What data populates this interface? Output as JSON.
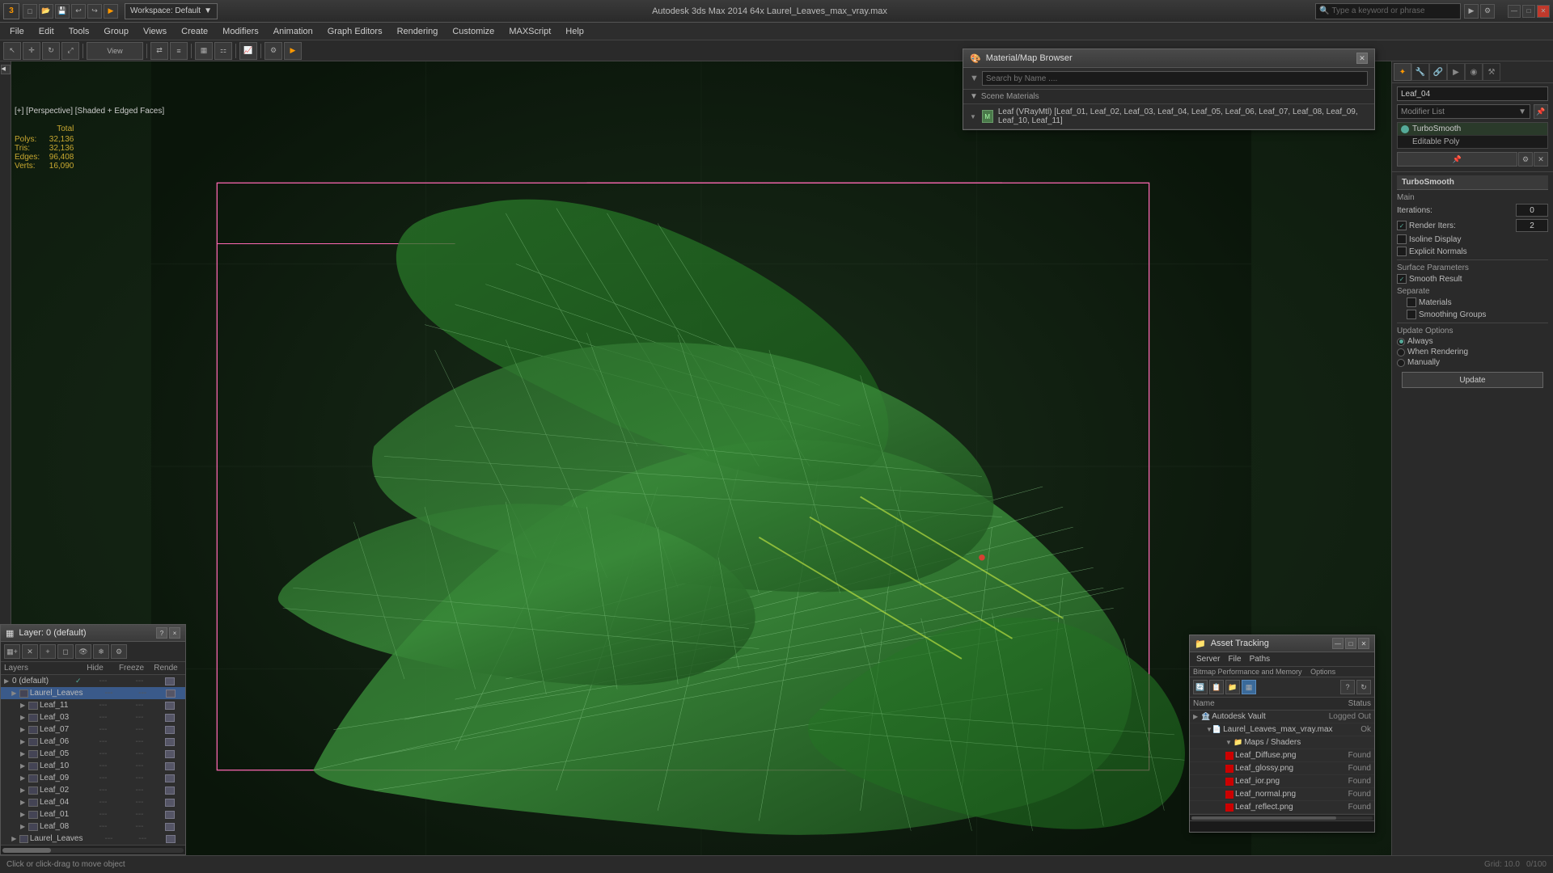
{
  "titlebar": {
    "logo": "3",
    "title": "Autodesk 3ds Max 2014 64x          Laurel_Leaves_max_vray.max",
    "workspace_label": "Workspace: Default",
    "search_placeholder": "Type a keyword or phrase",
    "window_controls": [
      "_",
      "□",
      "×"
    ]
  },
  "menubar": {
    "items": [
      "File",
      "Edit",
      "Tools",
      "Group",
      "Views",
      "Create",
      "Modifiers",
      "Animation",
      "Graph Editors",
      "Rendering",
      "Customize",
      "MAXScript",
      "Help"
    ]
  },
  "viewport": {
    "label": "[+] [Perspective] [Shaded + Edged Faces]",
    "stats": {
      "total_label": "Total",
      "polys_label": "Polys:",
      "polys_value": "32,136",
      "tris_label": "Tris:",
      "tris_value": "32,136",
      "edges_label": "Edges:",
      "edges_value": "96,408",
      "verts_label": "Verts:",
      "verts_value": "16,090"
    }
  },
  "right_panel": {
    "object_name": "Leaf_04",
    "modifier_list_label": "Modifier List",
    "modifiers": [
      {
        "name": "TurboSmooth",
        "active": true
      },
      {
        "name": "Editable Poly",
        "active": false
      }
    ],
    "turbosmooth": {
      "title": "TurboSmooth",
      "main_label": "Main",
      "iterations_label": "Iterations:",
      "iterations_value": "0",
      "render_iters_label": "Render Iters:",
      "render_iters_value": "2",
      "isoline_display_label": "Isoline Display",
      "explicit_normals_label": "Explicit Normals",
      "surface_params_label": "Surface Parameters",
      "smooth_result_label": "Smooth Result",
      "smooth_result_checked": true,
      "separate_label": "Separate",
      "materials_label": "Materials",
      "smoothing_groups_label": "Smoothing Groups",
      "update_options_label": "Update Options",
      "always_label": "Always",
      "when_rendering_label": "When Rendering",
      "manually_label": "Manually",
      "update_btn": "Update"
    }
  },
  "layer_panel": {
    "title": "Layer: 0 (default)",
    "question_btn": "?",
    "close_btn": "×",
    "toolbar_icons": [
      "layer_new",
      "layer_delete",
      "layer_add",
      "layer_select",
      "layer_hide",
      "layer_freeze",
      "layer_settings"
    ],
    "columns": {
      "name": "Layers",
      "hide": "Hide",
      "freeze": "Freeze",
      "render": "Rende"
    },
    "layers": [
      {
        "level": 0,
        "name": "0 (default)",
        "checked": true,
        "hide": "---",
        "freeze": "---",
        "render": "icon"
      },
      {
        "level": 1,
        "name": "Laurel_Leaves",
        "checked": false,
        "hide": "---",
        "freeze": "---",
        "render": "icon",
        "selected": true
      },
      {
        "level": 2,
        "name": "Leaf_11",
        "hide": "---",
        "freeze": "---",
        "render": "icon"
      },
      {
        "level": 2,
        "name": "Leaf_03",
        "hide": "---",
        "freeze": "---",
        "render": "icon"
      },
      {
        "level": 2,
        "name": "Leaf_07",
        "hide": "---",
        "freeze": "---",
        "render": "icon"
      },
      {
        "level": 2,
        "name": "Leaf_06",
        "hide": "---",
        "freeze": "---",
        "render": "icon"
      },
      {
        "level": 2,
        "name": "Leaf_05",
        "hide": "---",
        "freeze": "---",
        "render": "icon"
      },
      {
        "level": 2,
        "name": "Leaf_10",
        "hide": "---",
        "freeze": "---",
        "render": "icon"
      },
      {
        "level": 2,
        "name": "Leaf_09",
        "hide": "---",
        "freeze": "---",
        "render": "icon"
      },
      {
        "level": 2,
        "name": "Leaf_02",
        "hide": "---",
        "freeze": "---",
        "render": "icon"
      },
      {
        "level": 2,
        "name": "Leaf_04",
        "hide": "---",
        "freeze": "---",
        "render": "icon"
      },
      {
        "level": 2,
        "name": "Leaf_01",
        "hide": "---",
        "freeze": "---",
        "render": "icon"
      },
      {
        "level": 2,
        "name": "Leaf_08",
        "hide": "---",
        "freeze": "---",
        "render": "icon"
      },
      {
        "level": 1,
        "name": "Laurel_Leaves",
        "hide": "---",
        "freeze": "---",
        "render": "icon"
      }
    ]
  },
  "mat_browser": {
    "title": "Material/Map Browser",
    "search_label": "Search by Name ....",
    "scene_materials_label": "Scene Materials",
    "material_item": "Leaf (VRayMtl) [Leaf_01, Leaf_02, Leaf_03, Leaf_04, Leaf_05, Leaf_06, Leaf_07, Leaf_08, Leaf_09, Leaf_10, Leaf_11]"
  },
  "asset_tracking": {
    "title": "Asset Tracking",
    "menu_items": [
      "Server",
      "File",
      "Paths",
      "Bitmap Performance and Memory",
      "Options"
    ],
    "columns": {
      "name": "Name",
      "status": "Status"
    },
    "items": [
      {
        "level": 0,
        "name": "Autodesk Vault",
        "status": "Logged Out",
        "expand": "▶"
      },
      {
        "level": 1,
        "name": "Laurel_Leaves_max_vray.max",
        "status": "Ok",
        "expand": "▼"
      },
      {
        "level": 2,
        "name": "Maps / Shaders",
        "status": "",
        "expand": "▼"
      },
      {
        "level": 3,
        "name": "Leaf_Diffuse.png",
        "status": "Found"
      },
      {
        "level": 3,
        "name": "Leaf_glossy.png",
        "status": "Found"
      },
      {
        "level": 3,
        "name": "Leaf_ior.png",
        "status": "Found"
      },
      {
        "level": 3,
        "name": "Leaf_normal.png",
        "status": "Found"
      },
      {
        "level": 3,
        "name": "Leaf_reflect.png",
        "status": "Found"
      }
    ]
  },
  "icons": {
    "search": "🔍",
    "folder": "📁",
    "file": "📄",
    "layer": "▦",
    "expand": "▶",
    "collapse": "▼",
    "check": "✓",
    "close": "✕",
    "minimize": "—",
    "maximize": "□",
    "help": "?",
    "refresh": "↻",
    "camera": "📷"
  }
}
